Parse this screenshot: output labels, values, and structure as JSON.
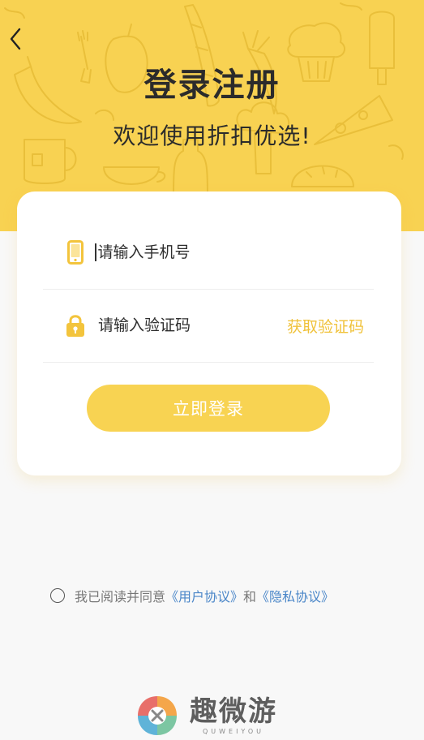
{
  "header": {
    "title": "登录注册",
    "subtitle": "欢迎使用折扣优选!"
  },
  "form": {
    "phone_placeholder": "请输入手机号",
    "code_placeholder": "请输入验证码",
    "get_code_label": "获取验证码",
    "login_label": "立即登录"
  },
  "agreement": {
    "prefix": "我已阅读并同意",
    "user_agreement": "《用户协议》",
    "conjunction": "和",
    "privacy_agreement": "《隐私协议》"
  },
  "watermark": {
    "name": "趣微游",
    "pinyin": "QUWEIYOU"
  },
  "colors": {
    "brand_yellow": "#f8d252",
    "link_blue": "#4a86c8",
    "accent_text": "#f0c23a"
  },
  "icons": [
    "back-arrow-icon",
    "phone-icon",
    "lock-icon",
    "radio-icon"
  ]
}
